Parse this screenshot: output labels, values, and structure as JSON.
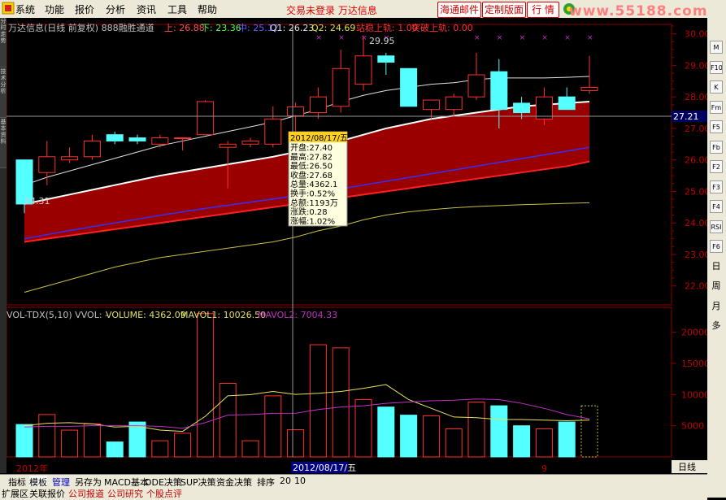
{
  "menu": {
    "items": [
      "系统",
      "功能",
      "报价",
      "分析",
      "资讯",
      "工具",
      "帮助"
    ],
    "status_text": "交易未登录  万达信息",
    "buttons": [
      "海通邮件",
      "定制版面",
      "行 情"
    ],
    "watermark": "www.55188.com"
  },
  "chart_header": {
    "title": "万达信息(日线 前复权) 888融胜通道",
    "up_label": "上: 26.88",
    "down_label": "下: 23.36",
    "mid_label": "中: 25.12",
    "q1_label": "Q1: 26.23",
    "q2_label": "Q2: 24.69",
    "stable_label": "站稳上轨: 1.00",
    "breakout_label": "突破上轨: 0.00"
  },
  "price_annotations": {
    "high": "29.95",
    "low": "24.31",
    "crosshair_price": "27.21"
  },
  "tooltip": {
    "date": "2012/08/17/五",
    "rows": [
      "开盘:27.40",
      "最高:27.82",
      "最低:26.50",
      "收盘:27.68",
      "总量:4362.1",
      "换手:0.52%",
      "总额:1193万",
      "涨跌:0.28",
      "涨幅:1.02%"
    ]
  },
  "vol_header": {
    "name": "VOL-TDX(5,10) VVOL: -",
    "volume": "VOLUME: 4362.09",
    "mavol1": "MAVOL1: 10026.50",
    "mavol2": "MAVOL2: 7004.33"
  },
  "time_axis": {
    "year": "2012年",
    "date": "2012/08/17/五",
    "month": "9",
    "period": "日线"
  },
  "bottom_tabs": [
    "指标",
    "模板",
    "管理",
    "另存为",
    "MACD基本",
    "DDE决策",
    "SUP决策",
    "资金决策",
    "排序",
    "20",
    "10"
  ],
  "bottom_tabs2": [
    "扩展区",
    "关联报价",
    "公司报道",
    "公司研究",
    "个股点评"
  ],
  "left_tabs": [
    "分时走势",
    "技术分析",
    "基本资料"
  ],
  "right_tools": [
    "M",
    "F10",
    "K",
    "Fm",
    "F5",
    "Fb",
    "F2",
    "F3",
    "F4",
    "RSI",
    "F6",
    "日",
    "周",
    "月",
    "多"
  ],
  "colors": {
    "up": "#ff3030",
    "down": "#54ffff",
    "channel_fill": "#9b0000",
    "upper_line": "#ffffff",
    "mid_line": "#3030ff",
    "lower_line": "#ff2020",
    "ma_yellow": "#c8c040",
    "ma_white": "#e0e0e0",
    "mavol1": "#e8e060",
    "mavol2": "#c030c0"
  },
  "chart_data": {
    "type": "candlestick",
    "price_axis": {
      "ticks": [
        22.0,
        23.0,
        24.0,
        25.0,
        26.0,
        27.0,
        28.0,
        29.0,
        30.0
      ],
      "ylim": [
        21.4,
        30.3
      ]
    },
    "volume_axis": {
      "ticks": [
        5000,
        10000,
        15000,
        20000
      ],
      "ylim": [
        0,
        24000
      ]
    },
    "candles": [
      {
        "o": 26.0,
        "h": 26.0,
        "l": 24.31,
        "c": 24.6
      },
      {
        "o": 25.6,
        "h": 26.6,
        "l": 25.2,
        "c": 26.1
      },
      {
        "o": 26.0,
        "h": 26.4,
        "l": 25.9,
        "c": 26.1
      },
      {
        "o": 26.1,
        "h": 26.8,
        "l": 26.0,
        "c": 26.6
      },
      {
        "o": 26.8,
        "h": 26.9,
        "l": 26.5,
        "c": 26.6
      },
      {
        "o": 26.7,
        "h": 26.8,
        "l": 26.5,
        "c": 26.6
      },
      {
        "o": 26.5,
        "h": 26.8,
        "l": 26.4,
        "c": 26.7
      },
      {
        "o": 26.7,
        "h": 26.7,
        "l": 26.3,
        "c": 26.7
      },
      {
        "o": 26.8,
        "h": 27.9,
        "l": 26.8,
        "c": 27.85
      },
      {
        "o": 26.4,
        "h": 26.6,
        "l": 25.1,
        "c": 26.5
      },
      {
        "o": 26.5,
        "h": 26.7,
        "l": 26.4,
        "c": 26.6
      },
      {
        "o": 26.5,
        "h": 27.7,
        "l": 26.4,
        "c": 27.3
      },
      {
        "o": 27.4,
        "h": 27.82,
        "l": 26.5,
        "c": 27.68
      },
      {
        "o": 27.5,
        "h": 28.3,
        "l": 27.3,
        "c": 28.0
      },
      {
        "o": 27.7,
        "h": 29.5,
        "l": 27.5,
        "c": 28.9
      },
      {
        "o": 28.4,
        "h": 29.95,
        "l": 28.2,
        "c": 29.3
      },
      {
        "o": 29.3,
        "h": 29.4,
        "l": 28.7,
        "c": 29.1
      },
      {
        "o": 28.9,
        "h": 28.9,
        "l": 27.7,
        "c": 27.7
      },
      {
        "o": 27.6,
        "h": 27.9,
        "l": 27.3,
        "c": 27.9
      },
      {
        "o": 27.6,
        "h": 28.1,
        "l": 27.4,
        "c": 28.0
      },
      {
        "o": 28.0,
        "h": 29.4,
        "l": 27.9,
        "c": 28.7
      },
      {
        "o": 28.8,
        "h": 29.2,
        "l": 27.0,
        "c": 27.6
      },
      {
        "o": 27.8,
        "h": 28.0,
        "l": 27.3,
        "c": 27.5
      },
      {
        "o": 27.3,
        "h": 28.3,
        "l": 27.1,
        "c": 28.0
      },
      {
        "o": 28.0,
        "h": 28.3,
        "l": 27.6,
        "c": 27.6
      },
      {
        "o": 28.2,
        "h": 29.3,
        "l": 28.1,
        "c": 28.3
      }
    ],
    "channel": {
      "upper": [
        24.6,
        24.75,
        24.9,
        25.05,
        25.2,
        25.35,
        25.5,
        25.62,
        25.74,
        25.86,
        25.98,
        26.1,
        26.25,
        26.4,
        26.6,
        26.8,
        27.0,
        27.15,
        27.3,
        27.4,
        27.5,
        27.6,
        27.7,
        27.75,
        27.8,
        27.85
      ],
      "mid": [
        23.5,
        23.63,
        23.76,
        23.88,
        24.0,
        24.12,
        24.24,
        24.35,
        24.46,
        24.56,
        24.66,
        24.76,
        24.86,
        24.96,
        25.08,
        25.2,
        25.32,
        25.44,
        25.56,
        25.68,
        25.8,
        25.92,
        26.04,
        26.16,
        26.28,
        26.4
      ],
      "lower": [
        23.4,
        23.5,
        23.6,
        23.7,
        23.8,
        23.9,
        24.0,
        24.1,
        24.2,
        24.3,
        24.4,
        24.5,
        24.6,
        24.7,
        24.8,
        24.9,
        25.0,
        25.1,
        25.2,
        25.3,
        25.4,
        25.5,
        25.6,
        25.7,
        25.8,
        25.95
      ]
    },
    "ma_white": [
      25.2,
      25.45,
      25.65,
      25.85,
      26.05,
      26.25,
      26.45,
      26.6,
      26.75,
      26.9,
      27.05,
      27.2,
      27.4,
      27.6,
      27.85,
      28.05,
      28.2,
      28.3,
      28.4,
      28.45,
      28.55,
      28.6,
      28.6,
      28.6,
      28.62,
      28.65
    ],
    "ma_yellow": [
      21.8,
      22.0,
      22.2,
      22.4,
      22.6,
      22.75,
      22.9,
      23.0,
      23.1,
      23.2,
      23.3,
      23.4,
      23.55,
      23.75,
      23.9,
      24.1,
      24.25,
      24.35,
      24.42,
      24.48,
      24.52,
      24.55,
      24.58,
      24.6,
      24.62,
      24.64
    ],
    "volumes": [
      5200,
      6800,
      4300,
      5300,
      2400,
      5600,
      2600,
      3800,
      23000,
      11800,
      2600,
      9800,
      4362,
      18000,
      17500,
      9200,
      8000,
      6700,
      6600,
      4500,
      8800,
      8200,
      5000,
      4500,
      5600,
      8200
    ],
    "mavol1": [
      5000,
      5400,
      5500,
      5300,
      4800,
      4900,
      4300,
      4100,
      6500,
      9800,
      10000,
      10500,
      10026,
      10200,
      10500,
      11000,
      11600,
      9200,
      7800,
      6400,
      6300,
      6000,
      6000,
      5900,
      5800,
      5900
    ],
    "mavol2": [
      4800,
      4900,
      4900,
      5000,
      5000,
      5000,
      4900,
      4600,
      5500,
      6700,
      6800,
      7000,
      7004,
      7600,
      8000,
      8200,
      8600,
      8800,
      9000,
      9100,
      9300,
      9200,
      8600,
      7800,
      6800,
      6100
    ]
  }
}
